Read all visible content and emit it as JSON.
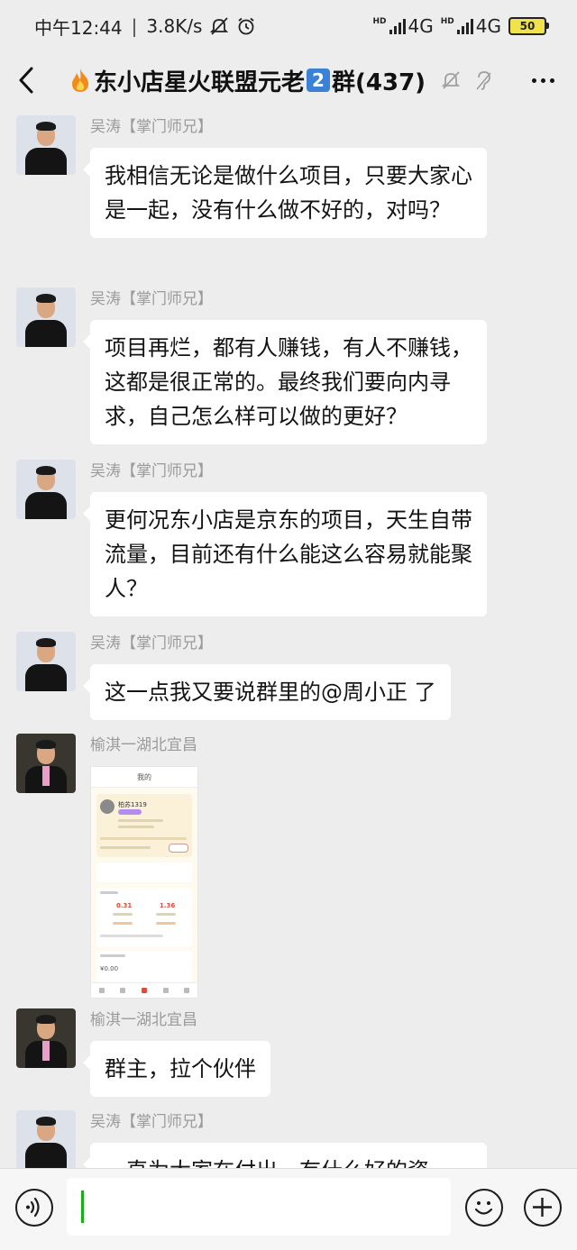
{
  "status_bar": {
    "time": "中午12:44",
    "speed": "3.8K/s",
    "sim1_label": "HD",
    "sim1_network": "4G",
    "sim2_label": "HD",
    "sim2_network": "4G",
    "battery": "50"
  },
  "header": {
    "title_prefix": "东小店星火联盟元老",
    "title_badge": "2",
    "title_suffix": "群(437)"
  },
  "messages": [
    {
      "sender": "吴涛【掌门师兄】",
      "text": "我相信无论是做什么项目，只要大家心是一起，没有什么做不好的，对吗？"
    },
    {
      "sender": "吴涛【掌门师兄】",
      "text": "项目再烂，都有人赚钱，有人不赚钱，这都是很正常的。最终我们要向内寻求，自己怎么样可以做的更好？"
    },
    {
      "sender": "吴涛【掌门师兄】",
      "text": "更何况东小店是京东的项目，天生自带流量，目前还有什么能这么容易就能聚人？"
    },
    {
      "sender": "吴涛【掌门师兄】",
      "text": "这一点我又要说群里的@周小正  了"
    },
    {
      "sender": "榆淇一湖北宜昌",
      "image": {
        "title": "我的",
        "name": "柏苏1319",
        "value1": "0.31",
        "value2": "1.36",
        "amount": "¥0.00"
      }
    },
    {
      "sender": "榆淇一湖北宜昌",
      "text": "群主，拉个伙伴"
    },
    {
      "sender": "吴涛【掌门师兄】",
      "text": "一直为大家在付出，有什么好的资"
    }
  ]
}
